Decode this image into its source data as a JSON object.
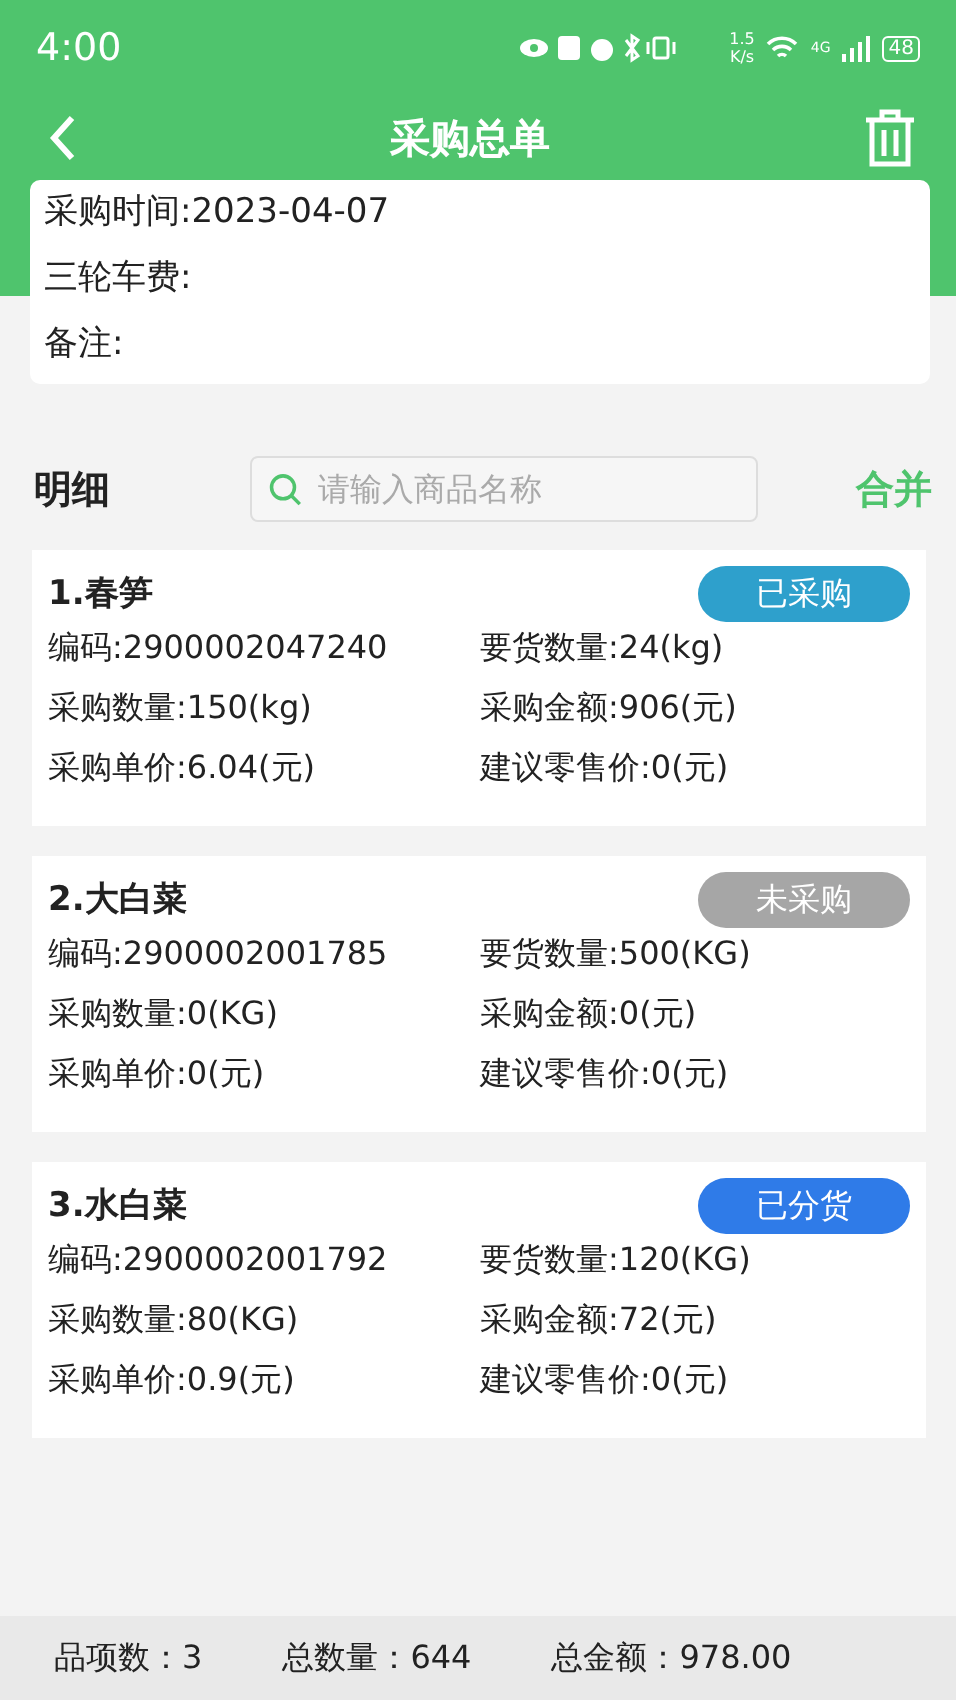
{
  "status_bar": {
    "time": "4:00",
    "speed_value": "1.5",
    "speed_unit": "K/s",
    "network": "4G",
    "battery": "48"
  },
  "header": {
    "title": "采购总单"
  },
  "info": [
    "采购时间:2023-04-07",
    "三轮车费:",
    "备注:"
  ],
  "detail": {
    "title": "明细",
    "search": {
      "placeholder": "请输入商品名称"
    },
    "merge": "合并"
  },
  "items": [
    {
      "name": "1.春笋",
      "status": "已采购",
      "color": "#2ea0cc",
      "fields": [
        "编码:2900002047240",
        "要货数量:24(kg)",
        "采购数量:150(kg)",
        "采购金额:906(元)",
        "采购单价:6.04(元)",
        "建议零售价:0(元)"
      ]
    },
    {
      "name": "2.大白菜",
      "status": "未采购",
      "color": "#a6a6a6",
      "fields": [
        "编码:2900002001785",
        "要货数量:500(KG)",
        "采购数量:0(KG)",
        "采购金额:0(元)",
        "采购单价:0(元)",
        "建议零售价:0(元)"
      ]
    },
    {
      "name": "3.水白菜",
      "status": "已分货",
      "color": "#2f7be8",
      "fields": [
        "编码:2900002001792",
        "要货数量:120(KG)",
        "采购数量:80(KG)",
        "采购金额:72(元)",
        "采购单价:0.9(元)",
        "建议零售价:0(元)"
      ]
    }
  ],
  "footer": [
    "品项数：3",
    "总数量：644",
    "总金额：978.00"
  ]
}
